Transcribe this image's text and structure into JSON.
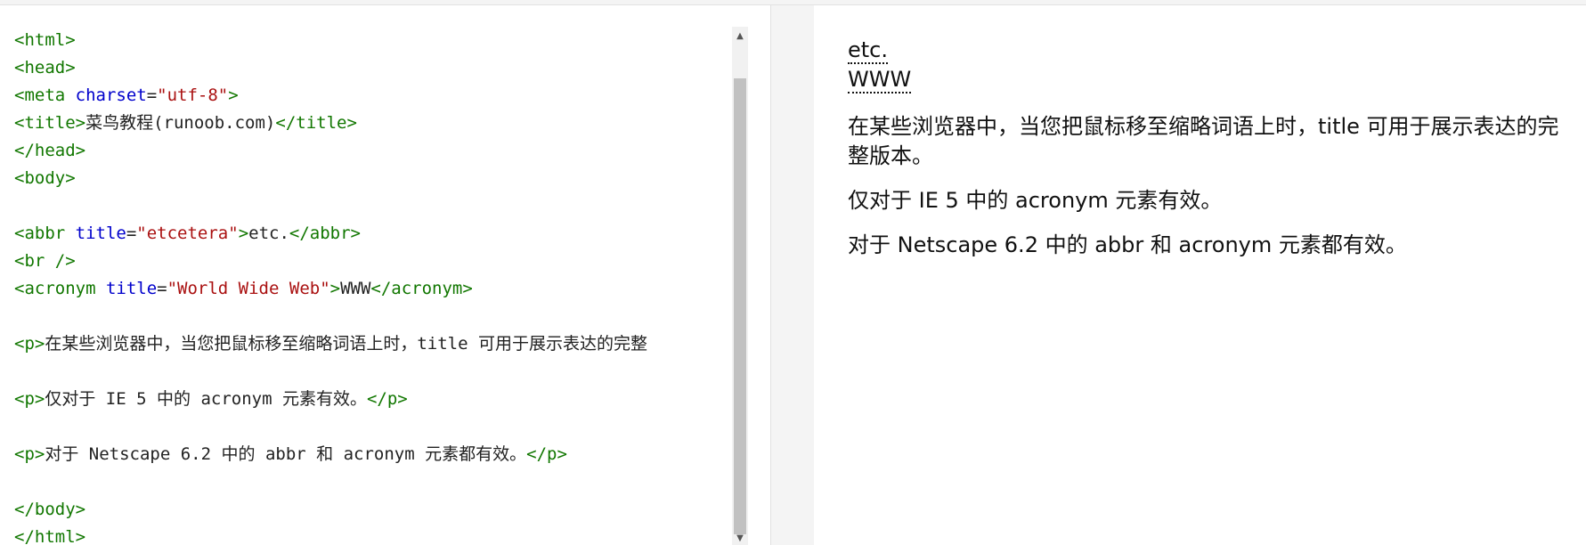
{
  "editor": {
    "lines": [
      {
        "parts": [
          [
            "tag",
            "<html>"
          ]
        ]
      },
      {
        "parts": [
          [
            "tag",
            "<head>"
          ]
        ]
      },
      {
        "parts": [
          [
            "tag",
            "<meta "
          ],
          [
            "attr",
            "charset"
          ],
          [
            "txt",
            "="
          ],
          [
            "str",
            "\"utf-8\""
          ],
          [
            "tag",
            ">"
          ]
        ]
      },
      {
        "parts": [
          [
            "tag",
            "<title>"
          ],
          [
            "cjk",
            "菜鸟教程"
          ],
          [
            "txt",
            "(runoob.com)"
          ],
          [
            "tag",
            "</title>"
          ]
        ]
      },
      {
        "parts": [
          [
            "tag",
            "</head>"
          ]
        ]
      },
      {
        "parts": [
          [
            "tag",
            "<body>"
          ]
        ]
      },
      {
        "parts": []
      },
      {
        "parts": [
          [
            "tag",
            "<abbr "
          ],
          [
            "attr",
            "title"
          ],
          [
            "txt",
            "="
          ],
          [
            "str",
            "\"etcetera\""
          ],
          [
            "tag",
            ">"
          ],
          [
            "txt",
            "etc."
          ],
          [
            "tag",
            "</abbr>"
          ]
        ]
      },
      {
        "parts": [
          [
            "tag",
            "<br />"
          ]
        ]
      },
      {
        "parts": [
          [
            "tag",
            "<acronym "
          ],
          [
            "attr",
            "title"
          ],
          [
            "txt",
            "="
          ],
          [
            "str",
            "\"World Wide Web\""
          ],
          [
            "tag",
            ">"
          ],
          [
            "txt",
            "WWW"
          ],
          [
            "tag",
            "</acronym>"
          ]
        ]
      },
      {
        "parts": []
      },
      {
        "parts": [
          [
            "tag",
            "<p>"
          ],
          [
            "cjk",
            "在某些浏览器中，当您把鼠标移至缩略词语上时，"
          ],
          [
            "txt",
            "title "
          ],
          [
            "cjk",
            "可用于展示表达的完整"
          ]
        ]
      },
      {
        "parts": []
      },
      {
        "parts": [
          [
            "tag",
            "<p>"
          ],
          [
            "cjk",
            "仅对于"
          ],
          [
            "txt",
            " IE 5 "
          ],
          [
            "cjk",
            "中的"
          ],
          [
            "txt",
            " acronym "
          ],
          [
            "cjk",
            "元素有效。"
          ],
          [
            "tag",
            "</p>"
          ]
        ]
      },
      {
        "parts": []
      },
      {
        "parts": [
          [
            "tag",
            "<p>"
          ],
          [
            "cjk",
            "对于"
          ],
          [
            "txt",
            " Netscape 6.2 "
          ],
          [
            "cjk",
            "中的"
          ],
          [
            "txt",
            " abbr "
          ],
          [
            "cjk",
            "和"
          ],
          [
            "txt",
            " acronym "
          ],
          [
            "cjk",
            "元素都有效。"
          ],
          [
            "tag",
            "</p>"
          ]
        ]
      },
      {
        "parts": []
      },
      {
        "parts": [
          [
            "tag",
            "</body>"
          ]
        ]
      },
      {
        "parts": [
          [
            "tag",
            "</html>"
          ]
        ]
      }
    ]
  },
  "preview": {
    "abbr_text": "etc.",
    "acronym_text": "WWW",
    "para1": "在某些浏览器中，当您把鼠标移至缩略词语上时，title 可用于展示表达的完整版本。",
    "para2": "仅对于 IE 5 中的 acronym 元素有效。",
    "para3": "对于 Netscape 6.2 中的 abbr 和 acronym 元素都有效。"
  },
  "scrollbar": {
    "up_arrow": "▲",
    "down_arrow": "▼"
  },
  "colors": {
    "tag": "#117700",
    "attribute": "#0000cc",
    "string": "#aa1111",
    "text": "#222222"
  }
}
